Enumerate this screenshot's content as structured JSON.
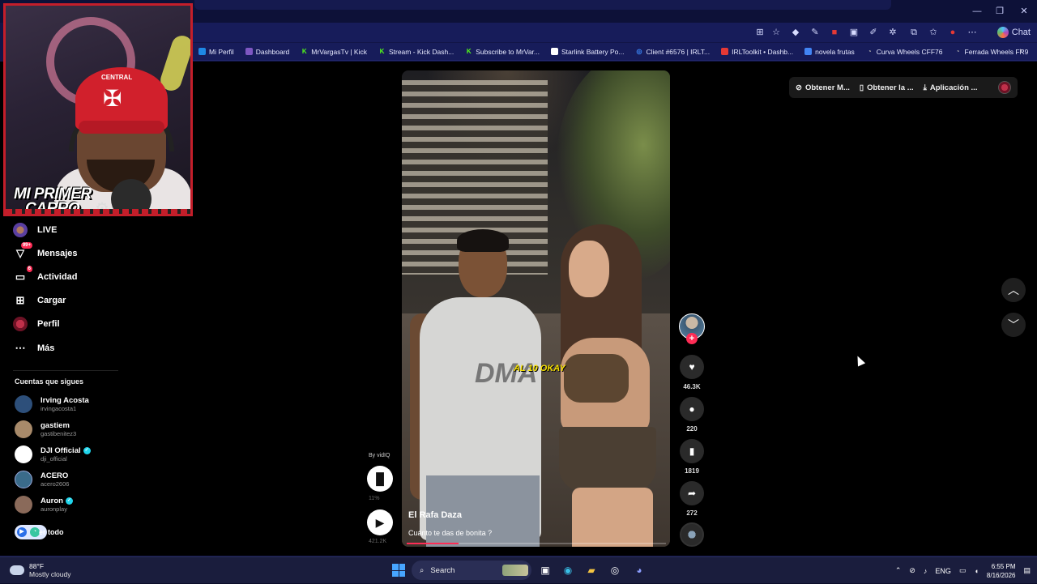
{
  "browser": {
    "toolbar": {
      "chat_label": "Chat"
    },
    "bookmarks": [
      {
        "label": "Mi Perfil",
        "color": "#1e88e5"
      },
      {
        "label": "Dashboard",
        "color": "#7e57c2"
      },
      {
        "label": "MrVargasTv | Kick",
        "color": "#53fc18"
      },
      {
        "label": "Stream - Kick Dash...",
        "color": "#53fc18"
      },
      {
        "label": "Subscribe to MrVar...",
        "color": "#53fc18"
      },
      {
        "label": "Starlink Battery Po...",
        "color": "#ffffff"
      },
      {
        "label": "Client #6576 | IRLT...",
        "color": "#3d8bfd"
      },
      {
        "label": "IRLToolkit • Dashb...",
        "color": "#e53935"
      },
      {
        "label": "novela frutas",
        "color": "#4285f4"
      },
      {
        "label": "Curva Wheels CFF76",
        "color": "#9e9e9e"
      },
      {
        "label": "Ferrada Wheels FR9",
        "color": "#9e9e9e"
      }
    ]
  },
  "webcam": {
    "overlay_title_line1": "MI PRIMER",
    "overlay_title_line2": "CARRO",
    "cap_text": "CENTRAL"
  },
  "sidebar": {
    "nav": [
      {
        "label": "LIVE",
        "icon": "live-avatar-icon"
      },
      {
        "label": "Mensajes",
        "icon": "messages-icon",
        "badge": "99+"
      },
      {
        "label": "Actividad",
        "icon": "activity-icon",
        "badge": "6"
      },
      {
        "label": "Cargar",
        "icon": "upload-icon"
      },
      {
        "label": "Perfil",
        "icon": "profile-avatar-icon"
      },
      {
        "label": "Más",
        "icon": "more-icon"
      }
    ],
    "following_header": "Cuentas que sigues",
    "accounts": [
      {
        "name": "Irving Acosta",
        "handle": "irvingacosta1",
        "verified": false
      },
      {
        "name": "gastiem",
        "handle": "gastibenitez3",
        "verified": false
      },
      {
        "name": "DJI Official",
        "handle": "dji_official",
        "verified": true
      },
      {
        "name": "ACERO",
        "handle": "acero2606",
        "verified": false
      },
      {
        "name": "Auron",
        "handle": "auronplay",
        "verified": true
      }
    ],
    "see_all_label": "er todo"
  },
  "top_actions": {
    "item1": "Obtener M...",
    "item2": "Obtener la ...",
    "item3": "Aplicación ..."
  },
  "video": {
    "author": "El Rafa Daza",
    "description": "Cuánto te das de bonita ?",
    "sticker_text": "AL 10 OKAY",
    "shirt_print": "DMA",
    "progress": 0.2
  },
  "actions": {
    "likes": "46.3K",
    "comments": "220",
    "saves": "1819",
    "shares": "272"
  },
  "vidiq": {
    "label": "By vidIQ",
    "stat1": "11%",
    "stat2": "421.2K"
  },
  "taskbar": {
    "temp": "88°F",
    "weather": "Mostly cloudy",
    "search_label": "Search",
    "lang": "ENG",
    "time": "6:55 PM",
    "date": "8/16/2026"
  }
}
